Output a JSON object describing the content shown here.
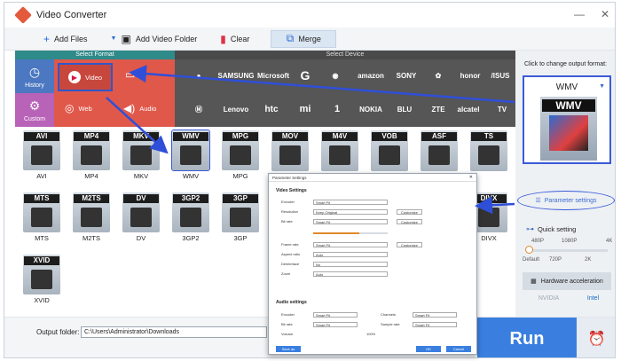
{
  "window": {
    "title": "Video Converter",
    "controls": [
      "—",
      "✕"
    ]
  },
  "toolbar": {
    "add_files": "Add Files",
    "add_folder": "Add Video Folder",
    "clear": "Clear",
    "merge": "Merge"
  },
  "headers": {
    "format": "Select Format",
    "device": "Select Device"
  },
  "side": {
    "history": "History",
    "custom": "Custom"
  },
  "categories": {
    "video": "Video",
    "audio": "Audio",
    "web": "Web"
  },
  "devices_row1": [
    "",
    "SAMSUNG",
    "Microsoft",
    "G",
    "",
    "amazon",
    "SONY",
    "",
    "honor",
    "/ISUS"
  ],
  "devices_row2": [
    "",
    "Lenovo",
    "htc",
    "mi",
    "1",
    "NOKIA",
    "BLU",
    "ZTE",
    "alcatel",
    "TV"
  ],
  "formats_row1": [
    "AVI",
    "MP4",
    "MKV",
    "WMV",
    "MPG",
    "MOV",
    "M4V",
    "VOB",
    "ASF",
    "TS"
  ],
  "formats_row2": [
    "MTS",
    "M2TS",
    "DV",
    "3GP2",
    "3GP",
    "DIVX"
  ],
  "formats_row3": [
    "XVID"
  ],
  "right": {
    "hint": "Click to change output format:",
    "format": "WMV",
    "param_btn": "Parameter settings",
    "quick": "Quick setting",
    "slider_top": [
      "480P",
      "1080P",
      "4K"
    ],
    "slider_bot": [
      "Default",
      "720P",
      "2K"
    ],
    "slider_level": 0,
    "hw": "Hardware acceleration",
    "vendors": [
      "NVIDIA",
      "Intel"
    ]
  },
  "bottom": {
    "output_label": "Output folder:",
    "output_path": "C:\\Users\\Administrator\\Downloads",
    "run": "Run"
  },
  "dialog": {
    "title": "Parameter Settings",
    "video_section": "Video Settings",
    "audio_section": "Audio settings",
    "video_rows": [
      {
        "k": "Encoder",
        "v": "Smart Fit",
        "b": ""
      },
      {
        "k": "Resolution",
        "v": "Keep Original",
        "b": "Customize"
      },
      {
        "k": "Bit rate",
        "v": "Smart Fit",
        "b": "Customize"
      },
      {
        "k": "Frame rate",
        "v": "Smart Fit",
        "b": "Customize"
      },
      {
        "k": "Aspect ratio",
        "v": "Auto",
        "b": ""
      },
      {
        "k": "Deinterlace",
        "v": "No",
        "b": ""
      },
      {
        "k": "Zoom",
        "v": "Auto",
        "b": ""
      }
    ],
    "audio_rows": [
      {
        "k": "Encoder",
        "v": "Smart Fit"
      },
      {
        "k": "Bit rate",
        "v": "Smart Fit"
      },
      {
        "k": "Volume",
        "v": "100%"
      }
    ],
    "audio_rows_right": [
      {
        "k": "Channels",
        "v": "Smart Fit"
      },
      {
        "k": "Sample rate",
        "v": "Smart Fit"
      }
    ],
    "foot_left": "Save as",
    "foot_ok": "OK",
    "foot_cancel": "Cancel"
  }
}
